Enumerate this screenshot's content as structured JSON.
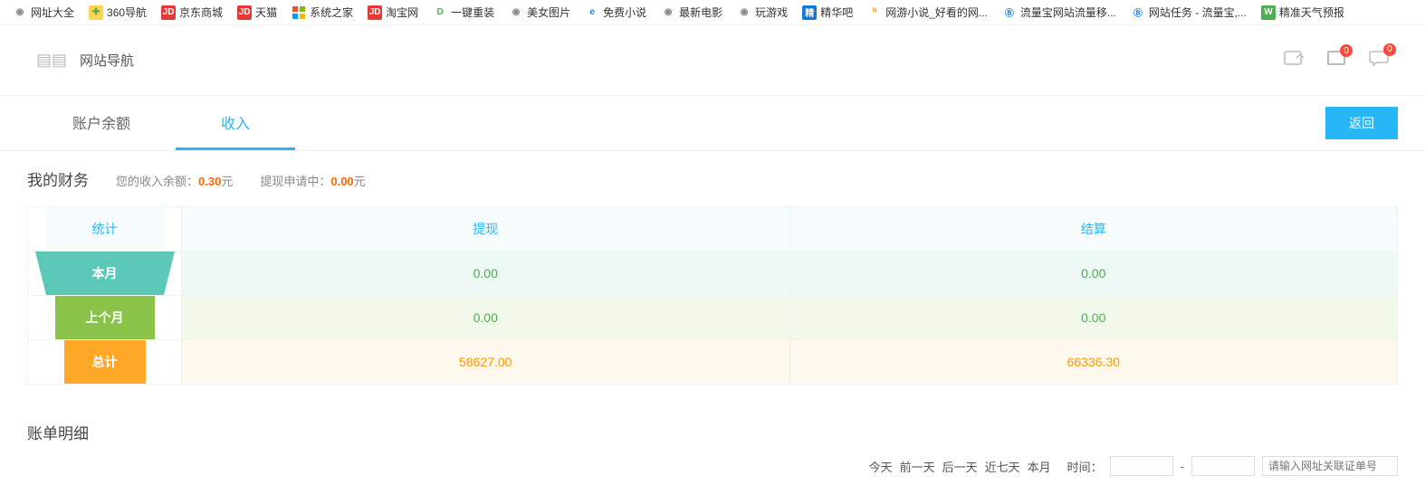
{
  "bookmarks": [
    {
      "label": "网址大全",
      "icon": "globe",
      "color": "#888"
    },
    {
      "label": "360导航",
      "icon": "360",
      "bg": "#8bc34a",
      "color": "#fff"
    },
    {
      "label": "京东商城",
      "icon": "JD",
      "bg": "#e53935",
      "color": "#fff"
    },
    {
      "label": "天猫",
      "icon": "JD",
      "bg": "#e53935",
      "color": "#fff"
    },
    {
      "label": "系统之家",
      "icon": "ms",
      "bg": "transparent",
      "color": "#00a4ef"
    },
    {
      "label": "淘宝网",
      "icon": "JD",
      "bg": "#e53935",
      "color": "#fff"
    },
    {
      "label": "一键重装",
      "icon": "D",
      "bg": "transparent",
      "color": "#4caf50"
    },
    {
      "label": "美女图片",
      "icon": "globe",
      "color": "#888"
    },
    {
      "label": "免费小说",
      "icon": "e",
      "bg": "transparent",
      "color": "#1e88e5"
    },
    {
      "label": "最新电影",
      "icon": "globe",
      "color": "#888"
    },
    {
      "label": "玩游戏",
      "icon": "globe",
      "color": "#888"
    },
    {
      "label": "精华吧",
      "icon": "精",
      "bg": "#1976d2",
      "color": "#fff"
    },
    {
      "label": "网游小说_好看的网...",
      "icon": "N",
      "bg": "transparent",
      "color": "#ff9800"
    },
    {
      "label": "流量宝网站流量移...",
      "icon": "B",
      "bg": "transparent",
      "color": "#1e88e5"
    },
    {
      "label": "网站任务 - 流量宝,...",
      "icon": "B",
      "bg": "transparent",
      "color": "#1e88e5"
    },
    {
      "label": "精准天气预报",
      "icon": "W",
      "bg": "#4caf50",
      "color": "#fff"
    }
  ],
  "nav": {
    "title": "网站导航",
    "favBadge": "0",
    "cartBadge": "0",
    "chatBadge": "0"
  },
  "tabs": {
    "balance": "账户余额",
    "income": "收入",
    "back": "返回"
  },
  "finance": {
    "title": "我的财务",
    "incomeLabel": "您的收入余额：",
    "incomeValue": "0.30",
    "incomeUnit": "元",
    "withdrawLabel": "提现申请中：",
    "withdrawValue": "0.00",
    "withdrawUnit": "元"
  },
  "stats": {
    "headers": {
      "stat": "统计",
      "withdraw": "提现",
      "settle": "结算"
    },
    "rows": [
      {
        "label": "本月",
        "withdraw": "0.00",
        "settle": "0.00",
        "cls": "teal"
      },
      {
        "label": "上个月",
        "withdraw": "0.00",
        "settle": "0.00",
        "cls": "green"
      },
      {
        "label": "总计",
        "withdraw": "58627.00",
        "settle": "66336.30",
        "cls": "orange"
      }
    ]
  },
  "billing": {
    "title": "账单明细",
    "filters": {
      "all": "今天",
      "prev": "前一天",
      "next": "后一天",
      "recent7": "近七天",
      "thisMonth": "本月",
      "time": "时间："
    },
    "searchPlaceholder": "请输入网址关联证单号"
  }
}
